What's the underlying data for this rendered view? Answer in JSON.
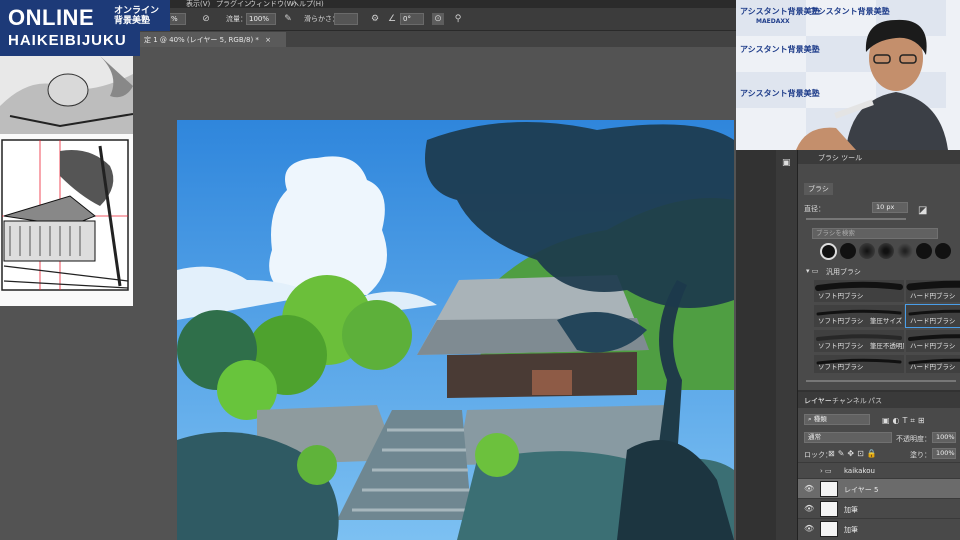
{
  "menu": [
    "表示(V)",
    "プラグイン",
    "ウィンドウ(W)",
    "ヘルプ(H)"
  ],
  "options": {
    "opacity_value": "%",
    "flow_label": "流量：",
    "flow_value": "100%",
    "smoothing_label": "滑らかさ：",
    "angle_value": "0°"
  },
  "logo": {
    "line1": "ONLINE",
    "line2": "オンライン 背景美塾",
    "line3": "HAIKEIBIJUKU"
  },
  "document": {
    "tab_title": "定 1 @ 40% (レイヤー 5, RGB/8) *"
  },
  "video": {
    "brand": "アシスタント背景美塾",
    "sub": "MAEDAXX"
  },
  "brush_panel": {
    "header": "ブラシ ツール",
    "tab": "ブラシ",
    "size_label": "直径：",
    "size_value": "10 px",
    "search_placeholder": "ブラシを検索",
    "folder": "汎用ブラシ",
    "presets": [
      "ソフト円ブラシ",
      "ハード円ブラシ",
      "ソフト円ブラシ　筆圧サイズ",
      "ハード円ブラシ",
      "ソフト円ブラシ　筆圧不透明度",
      "ハード円ブラシ",
      "ソフト円ブラシ",
      "ハード円ブラシ"
    ]
  },
  "layers_panel": {
    "tabs": [
      "レイヤー",
      "チャンネル",
      "パス"
    ],
    "filter_label": "種類",
    "blend_mode": "通常",
    "opacity_label": "不透明度：",
    "opacity_value": "100%",
    "lock_label": "ロック：",
    "fill_label": "塗り：",
    "fill_value": "100%",
    "layers": [
      {
        "name": "kaikakou",
        "type": "group"
      },
      {
        "name": "レイヤー 5",
        "type": "layer",
        "selected": true
      },
      {
        "name": "加筆",
        "type": "layer"
      },
      {
        "name": "加筆",
        "type": "layer"
      }
    ]
  },
  "colors": {
    "accent": "#1d3a78",
    "panel": "#323232",
    "sky": "#3a93e0"
  }
}
